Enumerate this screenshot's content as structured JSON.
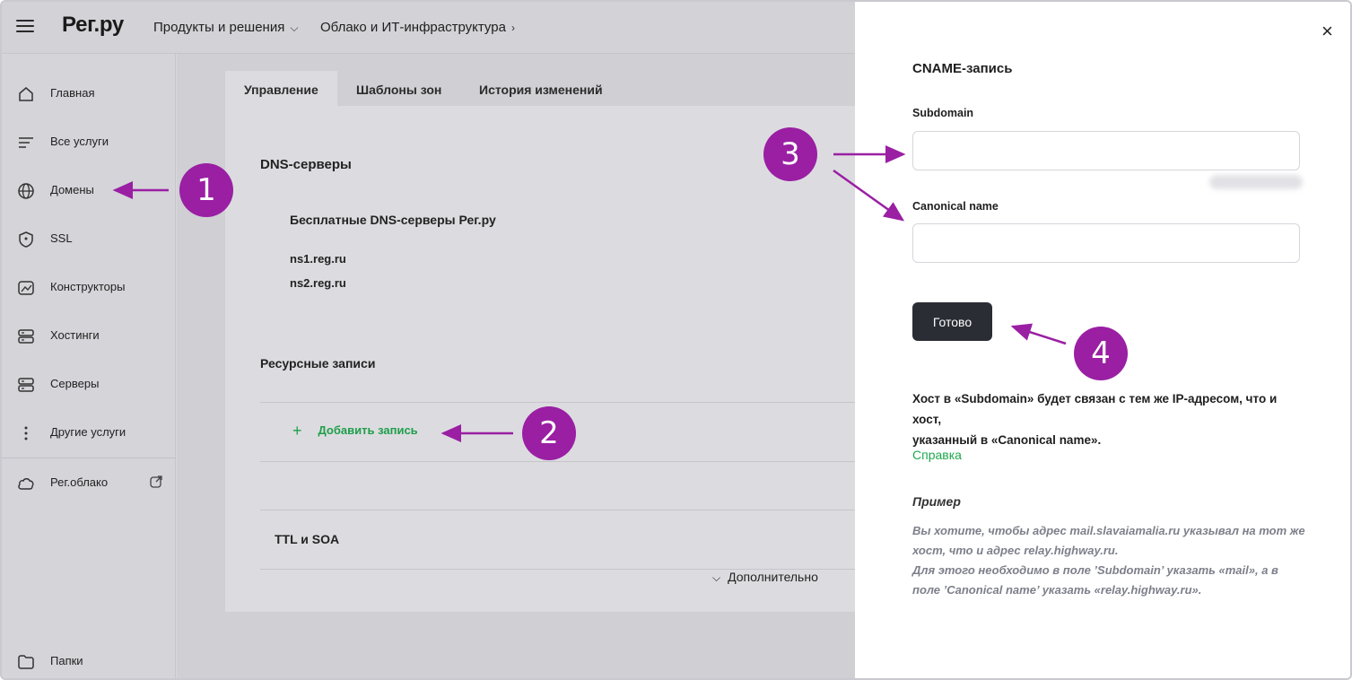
{
  "header": {
    "logo": "Рег.ру",
    "nav": [
      {
        "label": "Продукты и решения",
        "chevron": "⌵"
      },
      {
        "label": "Облако и ИТ-инфраструктура",
        "chevron": "›"
      }
    ]
  },
  "sidebar": {
    "items": [
      {
        "label": "Главная",
        "icon": "home-icon"
      },
      {
        "label": "Все услуги",
        "icon": "list-icon"
      },
      {
        "label": "Домены",
        "icon": "globe-icon"
      },
      {
        "label": "SSL",
        "icon": "shield-icon"
      },
      {
        "label": "Конструкторы",
        "icon": "constructor-icon"
      },
      {
        "label": "Хостинги",
        "icon": "server-icon"
      },
      {
        "label": "Серверы",
        "icon": "server-icon"
      },
      {
        "label": "Другие услуги",
        "icon": "more-icon"
      },
      {
        "label": "Рег.облако",
        "icon": "cloud-icon"
      },
      {
        "label": "Папки",
        "icon": "folder-icon"
      }
    ]
  },
  "main": {
    "tabs": [
      "Управление",
      "Шаблоны зон",
      "История изменений"
    ],
    "dns_title": "DNS-серверы",
    "dns_subtitle": "Бесплатные DNS-серверы Рег.ру",
    "ns": [
      "ns1.reg.ru",
      "ns2.reg.ru"
    ],
    "records_title": "Ресурсные записи",
    "add_record": "Добавить запись",
    "plus": "+",
    "ttl_title": "TTL и SOA",
    "more": "Дополнительно",
    "more_chevron": "⌵"
  },
  "modal": {
    "close": "×",
    "title": "CNAME-запись",
    "subdomain_label": "Subdomain",
    "subdomain_value": "",
    "canonical_label": "Canonical name",
    "canonical_value": "",
    "done_button": "Готово",
    "note_lines": [
      "Хост в «Subdomain» будет связан с тем же IP-адресом, что и хост,",
      "указанный в «Canonical name»."
    ],
    "help_link": "Справка",
    "example_title": "Пример",
    "example_lines": [
      "Вы хотите, чтобы адрес mail.slavaiamalia.ru указывал на тот же",
      "хост, что и адрес relay.highway.ru.",
      "Для этого необходимо в поле ’Subdomain’ указать «mail», а в",
      "поле ’Canonical name’ указать «relay.highway.ru»."
    ]
  },
  "annotations": [
    "1",
    "2",
    "3",
    "4"
  ],
  "colors": {
    "accent_green": "#1fa84d",
    "annotation_purple": "#9a1fa3",
    "button_dark": "#2a2d34"
  }
}
